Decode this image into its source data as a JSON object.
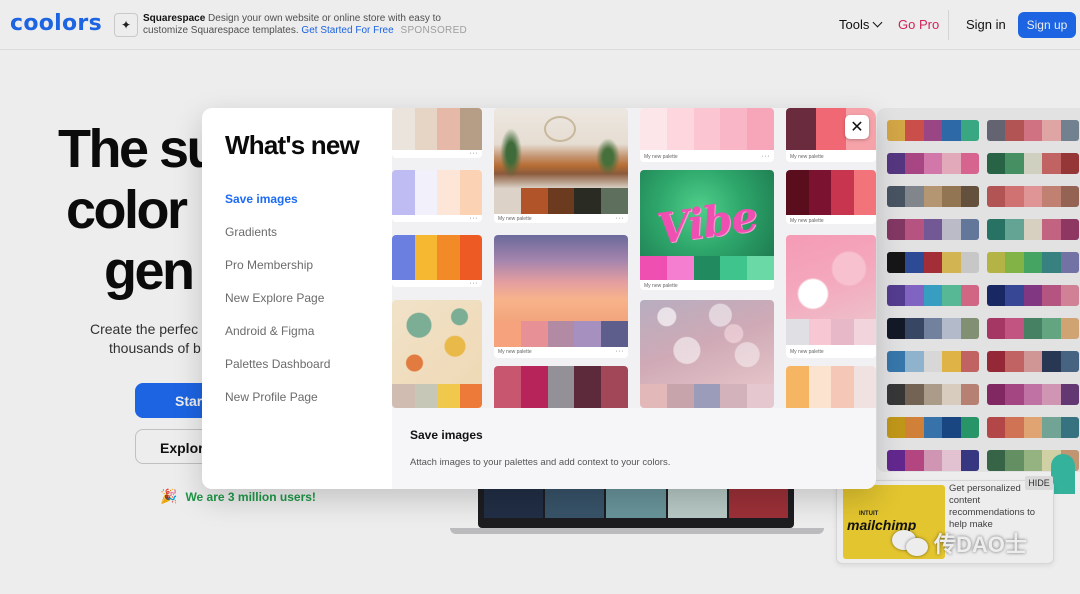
{
  "header": {
    "logo": "coolors",
    "ad": {
      "icon": "squarespace-icon",
      "brand": "Squarespace",
      "text": "Design your own website or online store with easy to customize Squarespace templates.",
      "cta": "Get Started For Free",
      "sponsored": "SPONSORED"
    },
    "tools_label": "Tools",
    "gopro_label": "Go Pro",
    "signin_label": "Sign in",
    "signup_label": "Sign up"
  },
  "hero": {
    "line1": "The su",
    "line2": "color",
    "line3": "gen",
    "sub_line1": "Create the perfec",
    "sub_line2": "thousands of b",
    "start_label": "Start",
    "explore_label": "Explore",
    "users_text": "We are 3 million users!",
    "users_icon": "party-popper-icon"
  },
  "modal": {
    "title": "What's new",
    "menu": [
      {
        "label": "Save images",
        "active": true
      },
      {
        "label": "Gradients",
        "active": false
      },
      {
        "label": "Pro Membership",
        "active": false
      },
      {
        "label": "New Explore Page",
        "active": false
      },
      {
        "label": "Android & Figma",
        "active": false
      },
      {
        "label": "Palettes Dashboard",
        "active": false
      },
      {
        "label": "New Profile Page",
        "active": false
      }
    ],
    "palette_label": "My new palette",
    "vibe_text": "Vibe",
    "detail_title": "Save images",
    "detail_desc": "Attach images to your palettes and add context to your colors.",
    "close_icon": "close-icon"
  },
  "mailchimp_ad": {
    "logo_small": "INTUIT",
    "logo_main": "mailchimp",
    "text": "Get personalized content recommendations to help make",
    "hide_label": "HIDE"
  },
  "watermark": "传DAO士",
  "colors": {
    "brand_blue": "#1d6bf3",
    "gopro_pink": "#e0245e",
    "users_green": "#1ea34a"
  }
}
